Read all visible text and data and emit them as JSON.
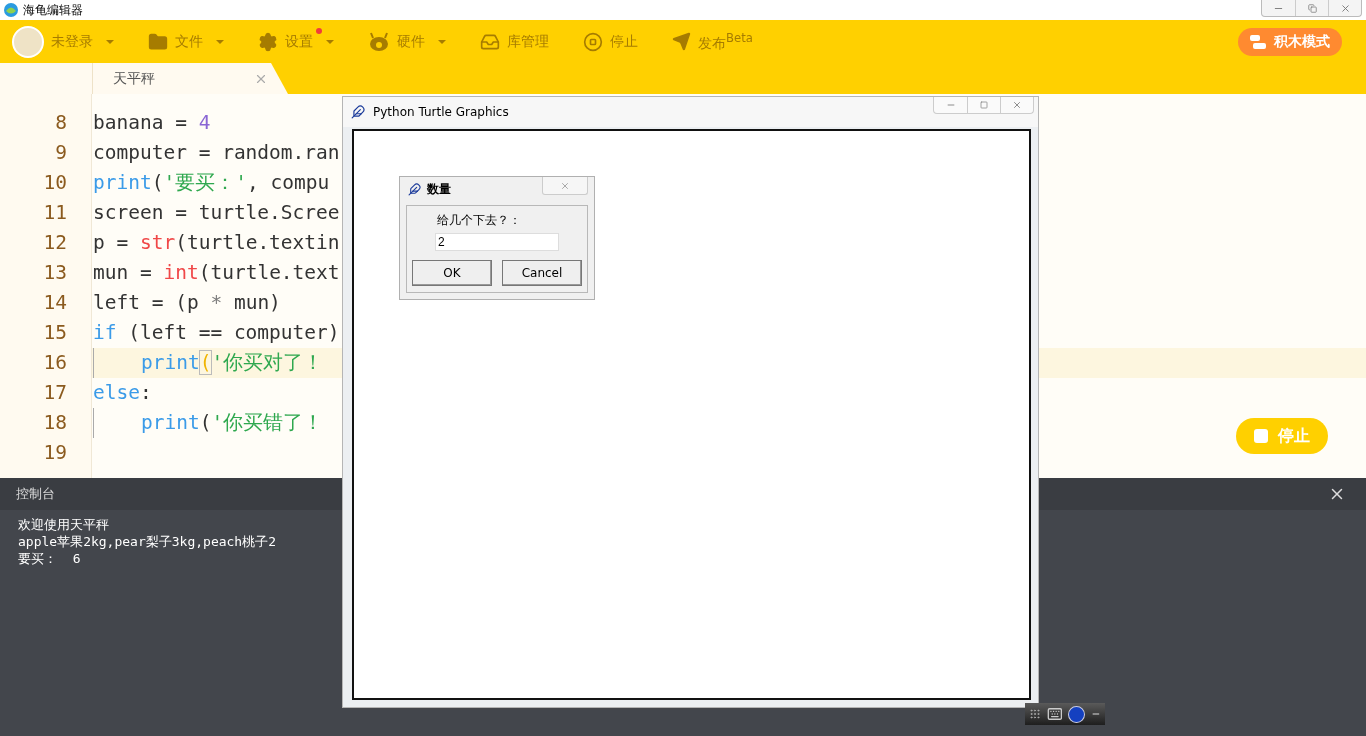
{
  "app_title": "海龟编辑器",
  "toolbar": [
    {
      "kind": "user",
      "label": "未登录",
      "caret": true,
      "badge": false
    },
    {
      "kind": "file",
      "label": "文件",
      "caret": true,
      "badge": false
    },
    {
      "kind": "settings",
      "label": "设置",
      "caret": true,
      "badge": true
    },
    {
      "kind": "hardware",
      "label": "硬件",
      "caret": true,
      "badge": false
    },
    {
      "kind": "library",
      "label": "库管理",
      "caret": false,
      "badge": false
    },
    {
      "kind": "stop",
      "label": "停止",
      "caret": false,
      "badge": false
    },
    {
      "kind": "publish",
      "label": "发布$^{Beta}$",
      "caret": false,
      "badge": false
    }
  ],
  "mode_button": "积木模式",
  "tabs": [
    {
      "label": "天平秤",
      "selected": true
    }
  ],
  "editor": {
    "lines": [
      {
        "number": "8",
        "current": false,
        "indented": false,
        "tokens": [
          {
            "kind": "plain",
            "text": "banana = "
          },
          {
            "kind": "number",
            "text": "4"
          }
        ]
      },
      {
        "number": "9",
        "current": false,
        "indented": false,
        "tokens": [
          {
            "kind": "plain",
            "text": "computer = random.ran"
          }
        ]
      },
      {
        "number": "10",
        "current": false,
        "indented": false,
        "tokens": [
          {
            "kind": "keyword",
            "text": "print"
          },
          {
            "kind": "plain",
            "text": "("
          },
          {
            "kind": "string",
            "text": "'要买：'"
          },
          {
            "kind": "plain",
            "text": ", compu"
          }
        ]
      },
      {
        "number": "11",
        "current": false,
        "indented": false,
        "tokens": [
          {
            "kind": "plain",
            "text": "screen = turtle.Scree"
          }
        ]
      },
      {
        "number": "12",
        "current": false,
        "indented": false,
        "tokens": [
          {
            "kind": "plain",
            "text": "p = "
          },
          {
            "kind": "builtin",
            "text": "str"
          },
          {
            "kind": "plain",
            "text": "(turtle.textin"
          }
        ]
      },
      {
        "number": "13",
        "current": false,
        "indented": false,
        "tokens": [
          {
            "kind": "plain",
            "text": "mun = "
          },
          {
            "kind": "builtin",
            "text": "int"
          },
          {
            "kind": "plain",
            "text": "(turtle.text"
          }
        ]
      },
      {
        "number": "14",
        "current": false,
        "indented": false,
        "tokens": [
          {
            "kind": "plain",
            "text": "left = (p "
          },
          {
            "kind": "operator",
            "text": "*"
          },
          {
            "kind": "plain",
            "text": " mun)"
          }
        ]
      },
      {
        "number": "15",
        "current": false,
        "indented": false,
        "tokens": [
          {
            "kind": "keyword",
            "text": "if"
          },
          {
            "kind": "plain",
            "text": " (left == computer)"
          }
        ]
      },
      {
        "number": "16",
        "current": true,
        "indented": true,
        "tokens": [
          {
            "kind": "keyword",
            "text": "print"
          },
          {
            "kind": "matched",
            "text": "("
          },
          {
            "kind": "string",
            "text": "'你买对了！"
          }
        ]
      },
      {
        "number": "17",
        "current": false,
        "indented": false,
        "tokens": [
          {
            "kind": "keyword",
            "text": "else"
          },
          {
            "kind": "plain",
            "text": ":"
          }
        ]
      },
      {
        "number": "18",
        "current": false,
        "indented": true,
        "tokens": [
          {
            "kind": "keyword",
            "text": "print"
          },
          {
            "kind": "plain",
            "text": "("
          },
          {
            "kind": "string",
            "text": "'你买错了！"
          }
        ]
      },
      {
        "number": "19",
        "current": false,
        "indented": false
      }
    ]
  },
  "run_button": "停止",
  "console": {
    "title": "控制台",
    "lines": [
      "欢迎使用天平秤",
      "apple苹果2kg,pear梨子3kg,peach桃子2",
      "要买：  6"
    ]
  },
  "turtle_window": {
    "title": "Python Turtle Graphics",
    "dialog": {
      "title": "数量",
      "prompt": "给几个下去？：",
      "value": "2",
      "buttons": [
        "OK",
        "Cancel"
      ]
    }
  }
}
